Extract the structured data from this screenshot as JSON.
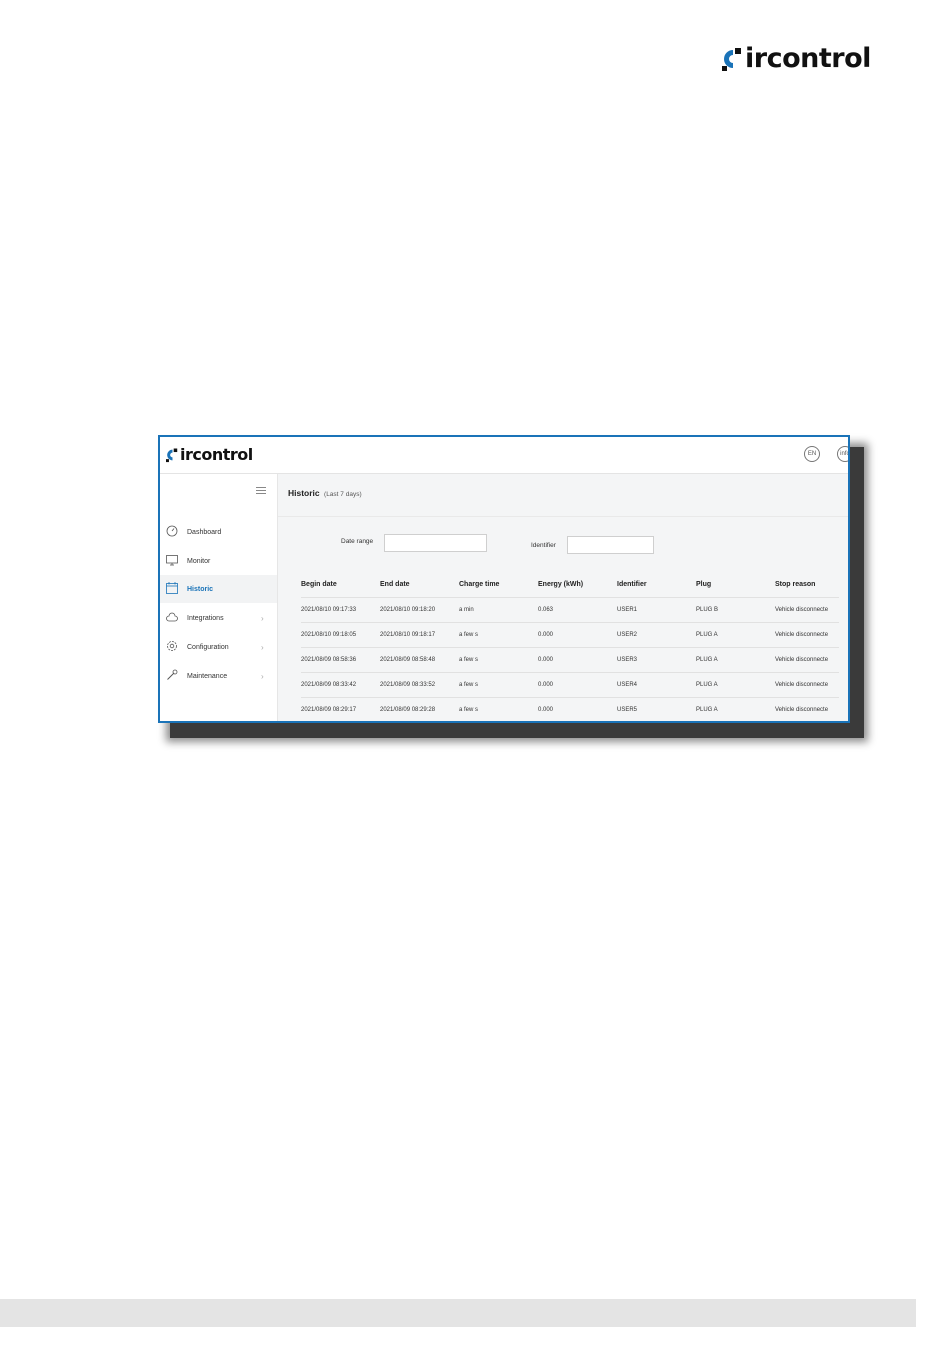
{
  "brand": {
    "name": "ircontrol",
    "accent": "#1a73b8"
  },
  "app": {
    "brand": "ircontrol",
    "header_buttons": [
      "EN",
      "info"
    ],
    "sidebar": {
      "items": [
        {
          "label": "Dashboard",
          "icon": "gauge-icon",
          "active": false,
          "has_submenu": false
        },
        {
          "label": "Monitor",
          "icon": "monitor-icon",
          "active": false,
          "has_submenu": false
        },
        {
          "label": "Historic",
          "icon": "calendar-icon",
          "active": true,
          "has_submenu": false
        },
        {
          "label": "Integrations",
          "icon": "cloud-icon",
          "active": false,
          "has_submenu": true
        },
        {
          "label": "Configuration",
          "icon": "gear-icon",
          "active": false,
          "has_submenu": true
        },
        {
          "label": "Maintenance",
          "icon": "wrench-icon",
          "active": false,
          "has_submenu": true
        }
      ]
    },
    "page": {
      "title": "Historic",
      "subtitle": "(Last 7 days)",
      "filters": {
        "date_range_label": "Date range",
        "date_range_value": "",
        "identifier_label": "Identifier",
        "identifier_value": ""
      },
      "table": {
        "columns": [
          "Begin date",
          "End date",
          "Charge time",
          "Energy (kWh)",
          "Identifier",
          "Plug",
          "Stop reason"
        ],
        "rows": [
          [
            "2021/08/10 09:17:33",
            "2021/08/10 09:18:20",
            "a min",
            "0.063",
            "USER1",
            "PLUG B",
            "Vehicle disconnecte"
          ],
          [
            "2021/08/10 09:18:05",
            "2021/08/10 09:18:17",
            "a few s",
            "0.000",
            "USER2",
            "PLUG A",
            "Vehicle disconnecte"
          ],
          [
            "2021/08/09 08:58:36",
            "2021/08/09 08:58:48",
            "a few s",
            "0.000",
            "USER3",
            "PLUG A",
            "Vehicle disconnecte"
          ],
          [
            "2021/08/09 08:33:42",
            "2021/08/09 08:33:52",
            "a few s",
            "0.000",
            "USER4",
            "PLUG A",
            "Vehicle disconnecte"
          ],
          [
            "2021/08/09 08:29:17",
            "2021/08/09 08:29:28",
            "a few s",
            "0.000",
            "USER5",
            "PLUG A",
            "Vehicle disconnecte"
          ]
        ]
      }
    }
  }
}
